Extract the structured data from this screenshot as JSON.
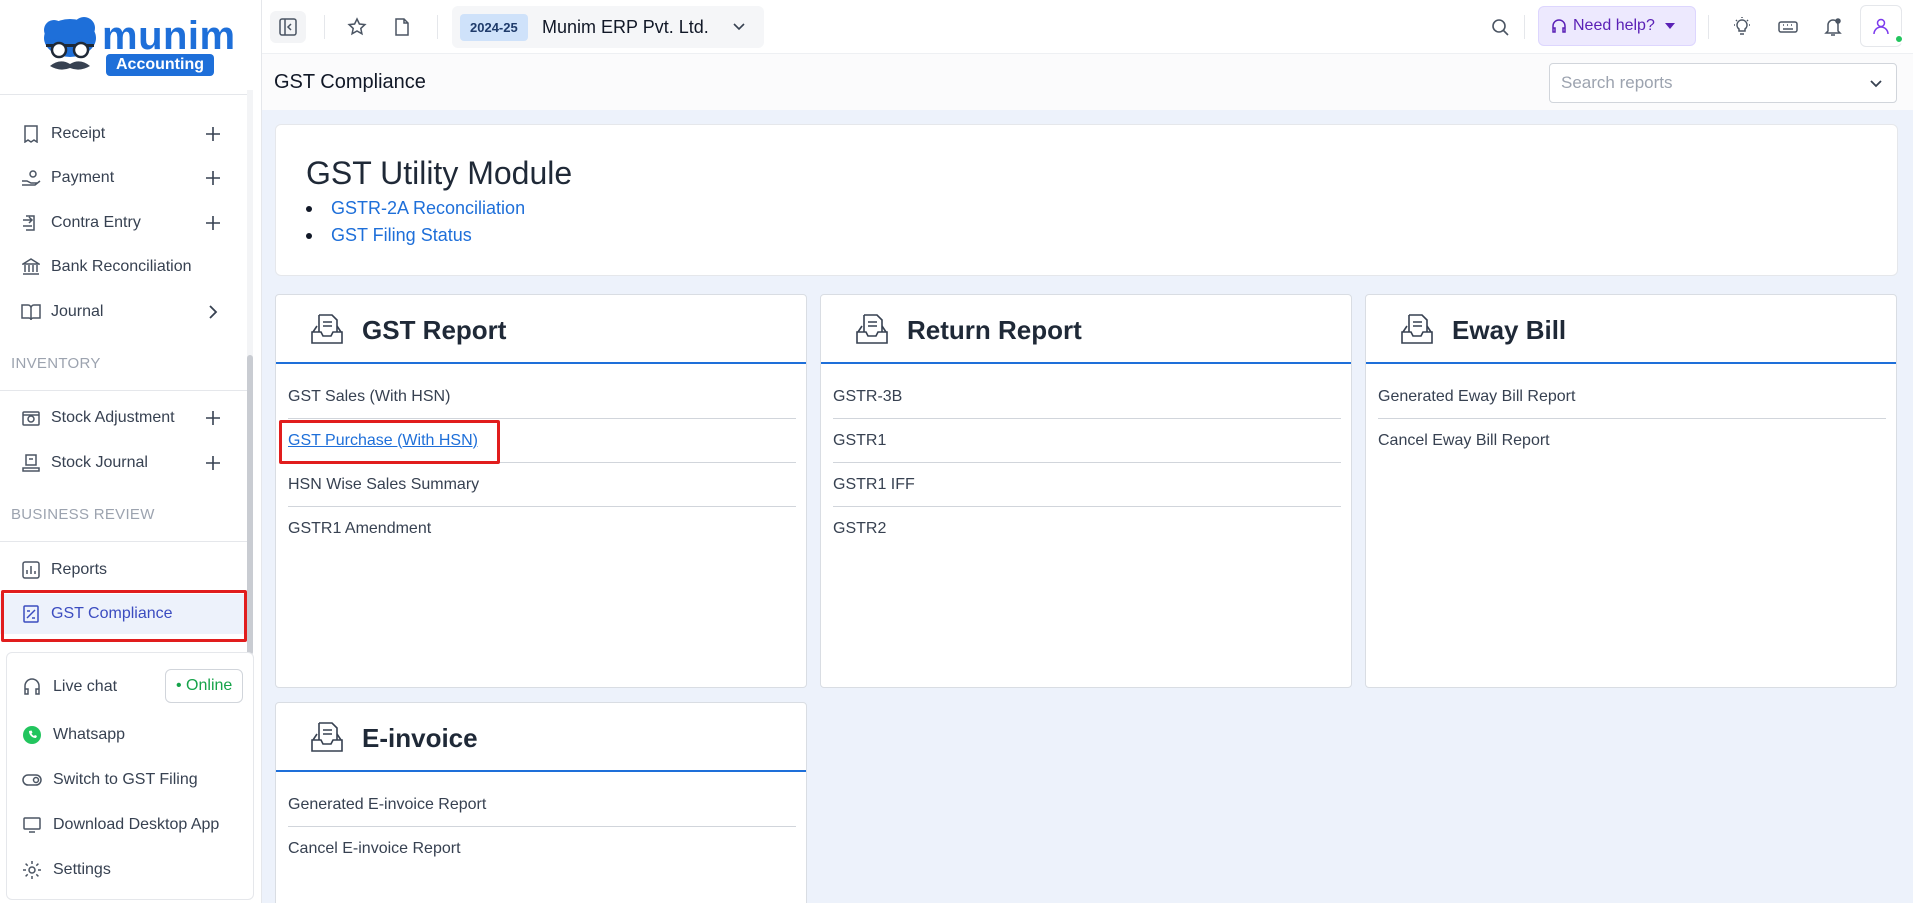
{
  "brand": {
    "name": "munim",
    "badge": "Accounting"
  },
  "sidebar": {
    "items": [
      {
        "label": "Receipt",
        "icon": "receipt-icon",
        "trail": "plus"
      },
      {
        "label": "Payment",
        "icon": "payment-icon",
        "trail": "plus"
      },
      {
        "label": "Contra Entry",
        "icon": "contra-entry-icon",
        "trail": "plus"
      },
      {
        "label": "Bank Reconciliation",
        "icon": "bank-icon",
        "trail": ""
      },
      {
        "label": "Journal",
        "icon": "book-icon",
        "trail": "chevron"
      }
    ],
    "inventory_heading": "INVENTORY",
    "inventory_items": [
      {
        "label": "Stock Adjustment",
        "icon": "stock-adjustment-icon",
        "trail": "plus"
      },
      {
        "label": "Stock Journal",
        "icon": "stock-journal-icon",
        "trail": "plus"
      }
    ],
    "business_heading": "BUSINESS REVIEW",
    "business_items": [
      {
        "label": "Reports",
        "icon": "reports-icon"
      },
      {
        "label": "GST Compliance",
        "icon": "gst-compliance-icon",
        "active": true
      }
    ],
    "support": {
      "live_chat": "Live chat",
      "online": "• Online",
      "whatsapp": "Whatsapp",
      "switch_gst": "Switch to GST Filing",
      "download_app": "Download Desktop App",
      "settings": "Settings"
    }
  },
  "topbar": {
    "financial_year": "2024-25",
    "company": "Munim ERP Pvt. Ltd.",
    "help": "Need help?"
  },
  "page": {
    "title": "GST Compliance",
    "search_placeholder": "Search reports"
  },
  "utility": {
    "title": "GST Utility Module",
    "links": [
      "GSTR-2A Reconciliation",
      "GST Filing Status"
    ]
  },
  "cards": [
    {
      "title": "GST Report",
      "items": [
        "GST Sales (With HSN)",
        "GST Purchase (With HSN)",
        "HSN Wise Sales Summary",
        "GSTR1 Amendment"
      ]
    },
    {
      "title": "Return Report",
      "items": [
        "GSTR-3B",
        "GSTR1",
        "GSTR1 IFF",
        "GSTR2"
      ]
    },
    {
      "title": "Eway Bill",
      "items": [
        "Generated Eway Bill Report",
        "Cancel Eway Bill Report"
      ]
    },
    {
      "title": "E-invoice",
      "items": [
        "Generated E-invoice Report",
        "Cancel E-invoice Report"
      ]
    }
  ],
  "colors": {
    "accent": "#1e6fd9",
    "highlight": "#e11d1d",
    "help_bg": "#ede9fe",
    "online": "#16a34a"
  }
}
